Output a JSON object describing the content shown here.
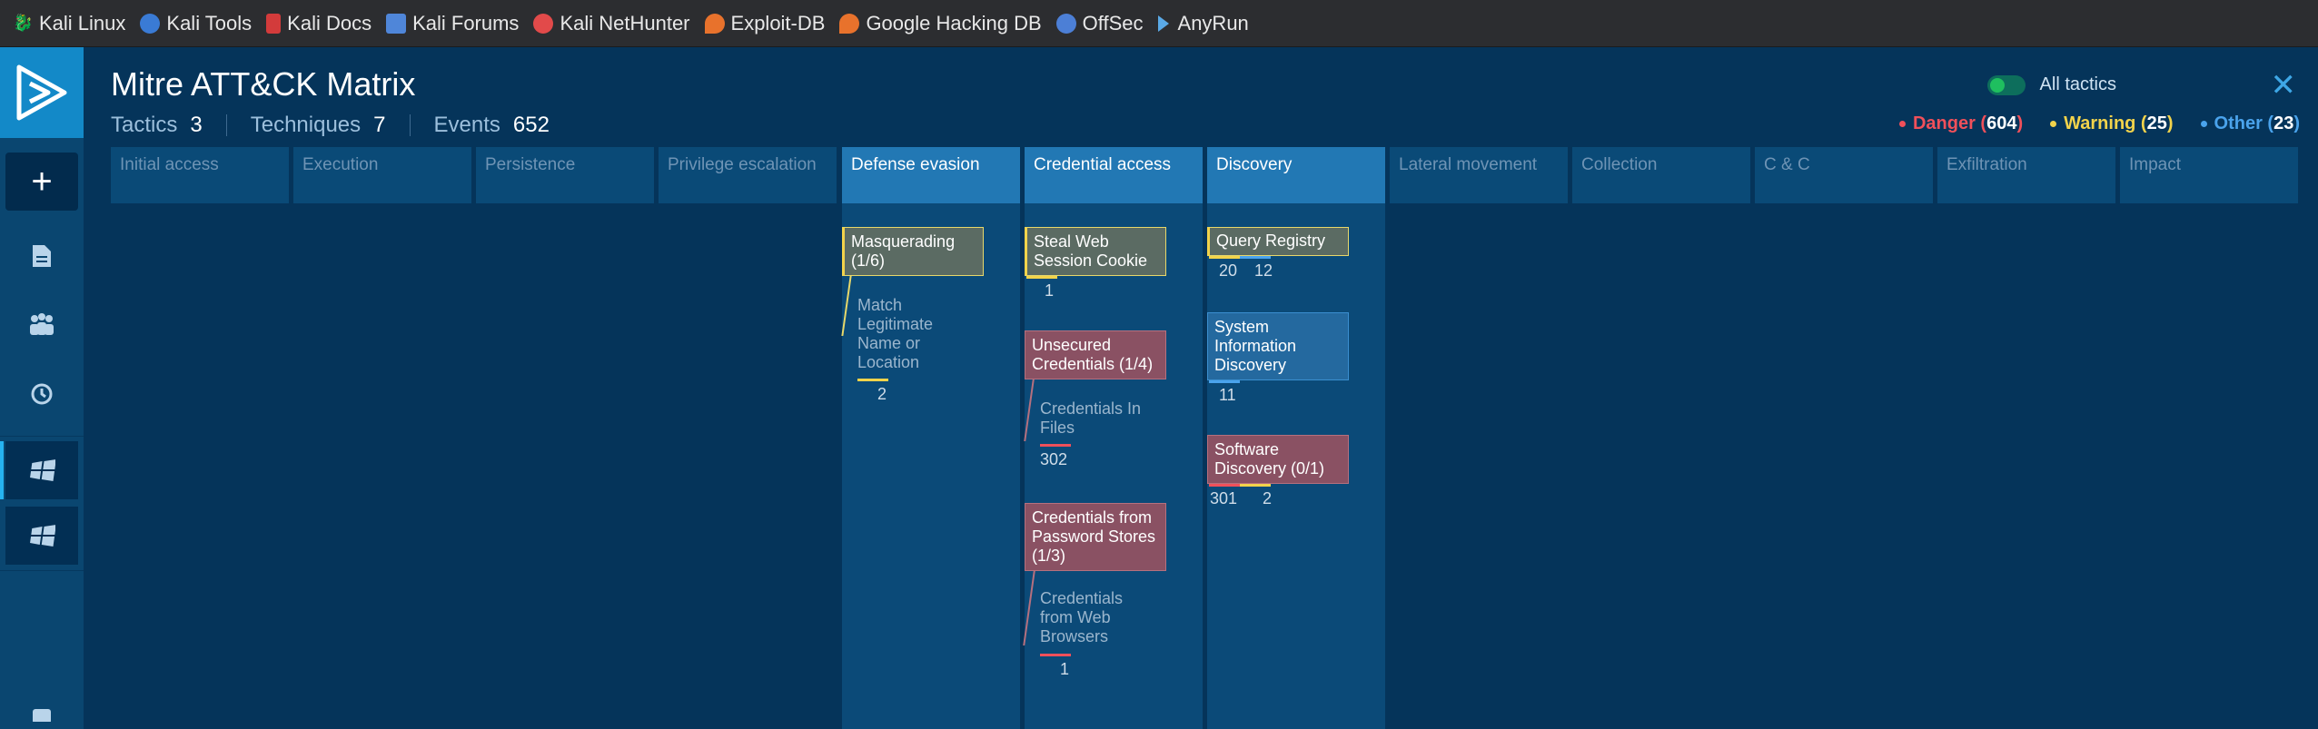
{
  "bookmarks": [
    {
      "label": "Kali Linux",
      "icon": "kali-dragon-icon",
      "color": "#d0d0d0"
    },
    {
      "label": "Kali Tools",
      "icon": "kali-tools-icon",
      "color": "#3a7bd5"
    },
    {
      "label": "Kali Docs",
      "icon": "kali-docs-icon",
      "color": "#d33b3b"
    },
    {
      "label": "Kali Forums",
      "icon": "kali-forums-icon",
      "color": "#4f86d9"
    },
    {
      "label": "Kali NetHunter",
      "icon": "kali-nethunter-icon",
      "color": "#e24a4a"
    },
    {
      "label": "Exploit-DB",
      "icon": "exploit-db-icon",
      "color": "#e8722c"
    },
    {
      "label": "Google Hacking DB",
      "icon": "ghdb-icon",
      "color": "#e8722c"
    },
    {
      "label": "OffSec",
      "icon": "offsec-icon",
      "color": "#4c7fd6"
    },
    {
      "label": "AnyRun",
      "icon": "anyrun-icon",
      "color": "#5aa9e6"
    }
  ],
  "header": {
    "title": "Mitre ATT&CK Matrix",
    "stats": [
      {
        "label": "Tactics",
        "value": "3"
      },
      {
        "label": "Techniques",
        "value": "7"
      },
      {
        "label": "Events",
        "value": "652"
      }
    ],
    "toggle_label": "All tactics",
    "legend": [
      {
        "label": "Danger",
        "count": "604",
        "color": "#f0505a"
      },
      {
        "label": "Warning",
        "count": "25",
        "color": "#f2d34b"
      },
      {
        "label": "Other",
        "count": "23",
        "color": "#4aa3ec"
      }
    ]
  },
  "tactics": [
    "Initial access",
    "Execution",
    "Persistence",
    "Privilege escalation",
    "Defense evasion",
    "Credential access",
    "Discovery",
    "Lateral movement",
    "Collection",
    "C & C",
    "Exfiltration",
    "Impact"
  ],
  "techniques": {
    "masquerading": {
      "label": "Masquerading (1/6)",
      "sub": "Match Legitimate Name or Location",
      "sub_count": "2"
    },
    "steal_cookie": {
      "label": "Steal Web Session Cookie",
      "count": "1"
    },
    "unsecured_creds": {
      "label": "Unsecured Credentials (1/4)",
      "sub": "Credentials In Files",
      "sub_count": "302"
    },
    "pw_stores": {
      "label": "Credentials from Password Stores (1/3)",
      "sub": "Credentials from Web Browsers",
      "sub_count": "1"
    },
    "query_registry": {
      "label": "Query Registry",
      "count_a": "20",
      "count_b": "12"
    },
    "sysinfo": {
      "label": "System Information Discovery",
      "count": "11"
    },
    "software": {
      "label": "Software Discovery (0/1)",
      "count_a": "301",
      "count_b": "2"
    }
  }
}
